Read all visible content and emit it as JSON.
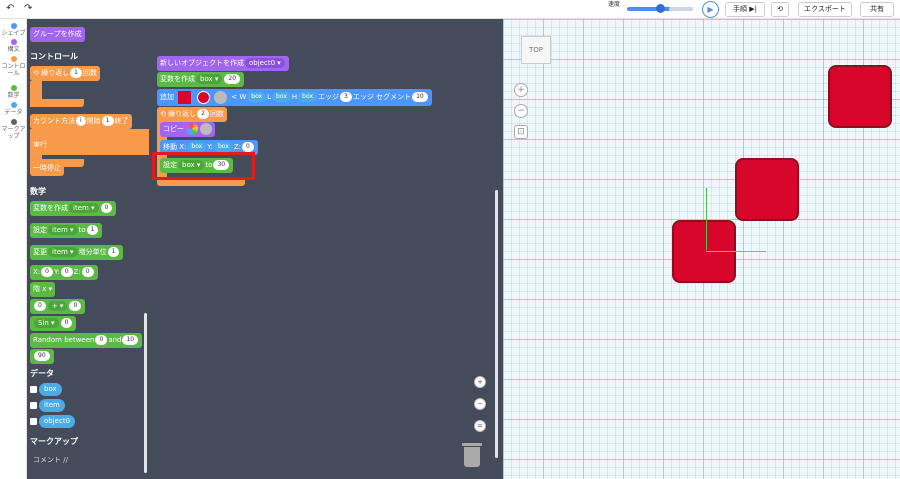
{
  "toolbar": {
    "speed_label": "速度",
    "play_icon": "play-icon",
    "step_label": "手順",
    "export_label": "エクスポート",
    "share_label": "共有"
  },
  "sidebar": {
    "items": [
      {
        "label": "シェイプ",
        "color": "#4c97ff"
      },
      {
        "label": "構文",
        "color": "#a166f0"
      },
      {
        "label": "コントロール",
        "color": "#f79a4a"
      },
      {
        "label": "数学",
        "color": "#5cb946"
      },
      {
        "label": "データ",
        "color": "#4aace6"
      },
      {
        "label": "マークアップ",
        "color": "#5a6270"
      }
    ]
  },
  "palette": {
    "group_create": "グループを作成",
    "control_title": "コントロール",
    "repeat": {
      "label": "繰り返し",
      "value": "1",
      "suffix": "回数"
    },
    "count_with": {
      "label": "カウント方法",
      "var": "i",
      "start_label": "開始",
      "start": "1",
      "end_label": "終了"
    },
    "do_label": "実行",
    "pause": "一時停止",
    "math_title": "数学",
    "create_var": {
      "label": "変数を作成",
      "var": "item",
      "value": "0"
    },
    "set_var": {
      "label": "設定",
      "var": "item",
      "to": "to",
      "value": "1"
    },
    "change_var": {
      "label": "変更",
      "var": "item",
      "by": "増分単位",
      "value": "1"
    },
    "xyz": {
      "x": "X:",
      "xv": "0",
      "y": "Y:",
      "yv": "0",
      "z": "Z:",
      "zv": "0"
    },
    "sqrt": "階 x",
    "arith": {
      "a": "0",
      "op": "+",
      "b": "0"
    },
    "sin": {
      "fn": "Sin",
      "value": "0"
    },
    "random": {
      "label": "Random between",
      "a": "0",
      "and": "and",
      "b": "10"
    },
    "number": "90",
    "data_title": "データ",
    "data_vars": [
      "box",
      "item",
      "object0"
    ],
    "markup_title": "マークアップ",
    "comment": "コメント //"
  },
  "workspace": {
    "new_object": {
      "label": "新しいオブジェクトを作成",
      "name": "object0"
    },
    "create_var": {
      "label": "変数を作成",
      "var": "box",
      "value": "20"
    },
    "add": {
      "label": "追加",
      "w": "W",
      "w_var": "box",
      "l": "L",
      "l_var": "box",
      "h": "H",
      "h_var": "box",
      "edge_label": "エッジ",
      "edge_value": "3",
      "segment_label": "エッジ セグメント",
      "segment_value": "10"
    },
    "repeat": {
      "label": "繰り返し",
      "value": "2",
      "suffix": "回数"
    },
    "copy": {
      "label": "コピー"
    },
    "move": {
      "label": "移動",
      "x": "X:",
      "x_var": "box",
      "y": "Y:",
      "y_var": "box",
      "z": "Z:",
      "z_value": "0"
    },
    "set_var": {
      "label": "設定",
      "var": "box",
      "to": "to",
      "value": "30"
    }
  },
  "viewport": {
    "view_cube": "TOP",
    "shape_color": "#d9062b"
  }
}
